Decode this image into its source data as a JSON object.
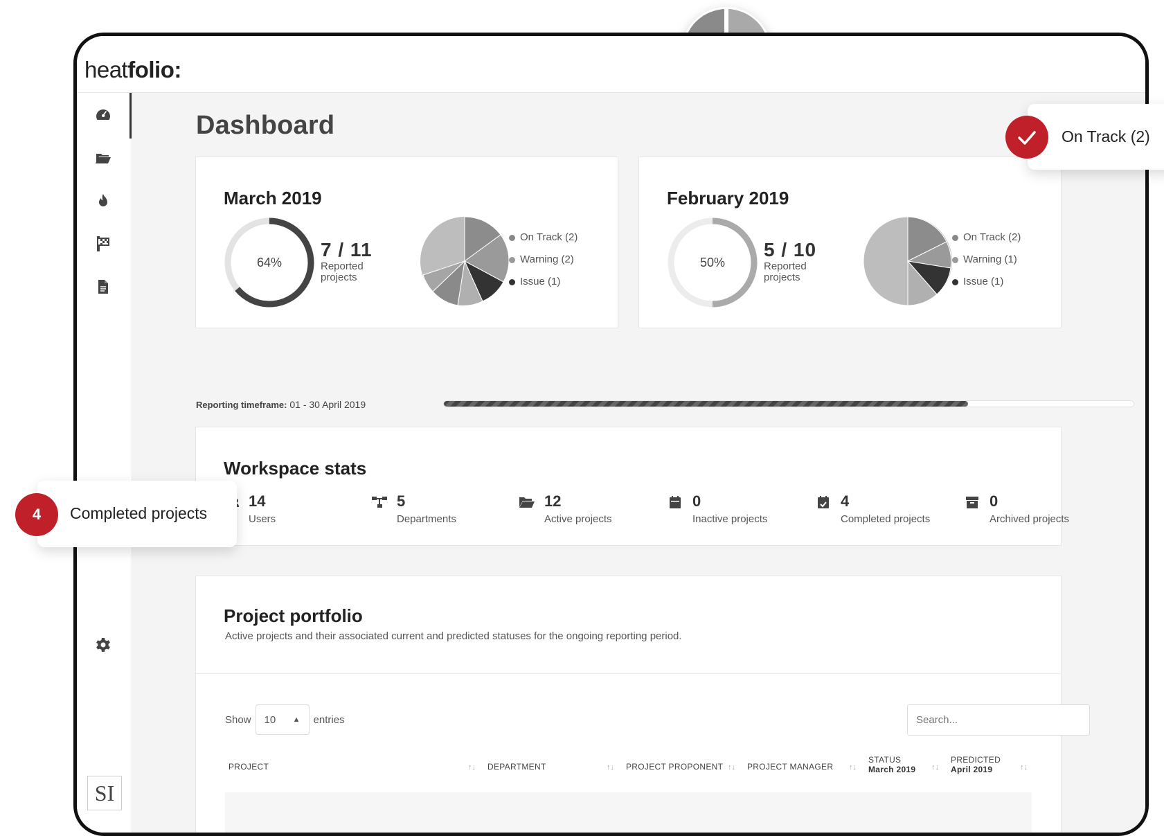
{
  "app": {
    "logo_part1": "heat",
    "logo_part2": "folio:"
  },
  "page_title": "Dashboard",
  "sidebar": {
    "items": [
      {
        "icon": "dashboard-icon"
      },
      {
        "icon": "folder-open-icon"
      },
      {
        "icon": "fire-icon"
      },
      {
        "icon": "flag-icon"
      },
      {
        "icon": "file-icon"
      }
    ],
    "settings_icon": "gear-icon",
    "avatar_initials": "SI"
  },
  "cards": [
    {
      "title": "March 2019",
      "ring_percent": 64,
      "ring_label": "64%",
      "fraction": "7 / 11",
      "reported_label": "Reported projects",
      "legend": [
        {
          "label": "On Track (2)",
          "color": "#888888"
        },
        {
          "label": "Warning (2)",
          "color": "#9a9a9a"
        },
        {
          "label": "Issue (1)",
          "color": "#333333"
        }
      ]
    },
    {
      "title": "February 2019",
      "ring_percent": 50,
      "ring_label": "50%",
      "fraction": "5 / 10",
      "reported_label": "Reported projects",
      "legend": [
        {
          "label": "On Track (2)",
          "color": "#888888"
        },
        {
          "label": "Warning (1)",
          "color": "#9a9a9a"
        },
        {
          "label": "Issue (1)",
          "color": "#333333"
        }
      ]
    }
  ],
  "timeframe": {
    "label": "Reporting timeframe:",
    "value": "01 - 30 April 2019",
    "progress": 0.76
  },
  "workspace": {
    "title": "Workspace stats",
    "stats": [
      {
        "value": "14",
        "label": "Users",
        "icon": "users-icon"
      },
      {
        "value": "5",
        "label": "Departments",
        "icon": "sitemap-icon"
      },
      {
        "value": "12",
        "label": "Active projects",
        "icon": "folder-open-icon"
      },
      {
        "value": "0",
        "label": "Inactive projects",
        "icon": "calendar-icon"
      },
      {
        "value": "4",
        "label": "Completed projects",
        "icon": "calendar-check-icon"
      },
      {
        "value": "0",
        "label": "Archived projects",
        "icon": "archive-icon"
      }
    ]
  },
  "portfolio": {
    "title": "Project portfolio",
    "subtitle": "Active projects and their associated current and predicted statuses for the ongoing reporting period.",
    "show_label": "Show",
    "entries_value": "10",
    "entries_label": "entries",
    "search_placeholder": "Search...",
    "columns": [
      {
        "label": "PROJECT",
        "sub": ""
      },
      {
        "label": "DEPARTMENT",
        "sub": ""
      },
      {
        "label": "PROJECT PROPONENT",
        "sub": ""
      },
      {
        "label": "PROJECT MANAGER",
        "sub": ""
      },
      {
        "label": "STATUS",
        "sub": "March 2019"
      },
      {
        "label": "PREDICTED",
        "sub": "April 2019"
      }
    ]
  },
  "callouts": {
    "on_track": {
      "text": "On Track (2)",
      "color": "#c0202a"
    },
    "completed": {
      "number": "4",
      "text": "Completed projects",
      "color": "#c0202a"
    }
  }
}
